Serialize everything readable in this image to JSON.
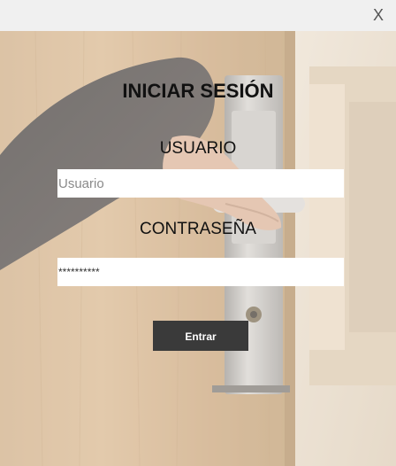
{
  "window": {
    "close_label": "X"
  },
  "login": {
    "title": "INICIAR SESIÓN",
    "username_label": "USUARIO",
    "username_placeholder": "Usuario",
    "username_value": "",
    "password_label": "CONTRASEÑA",
    "password_value": "**********",
    "submit_label": "Entrar"
  },
  "background": {
    "description_icon": "door-handle-photo",
    "wall_color": "#c99f6e",
    "door_color": "#b98b58",
    "handle_color": "#b8b3ab"
  },
  "colors": {
    "button_bg": "#3a3a3a",
    "titlebar_bg": "#f0f0f0"
  }
}
